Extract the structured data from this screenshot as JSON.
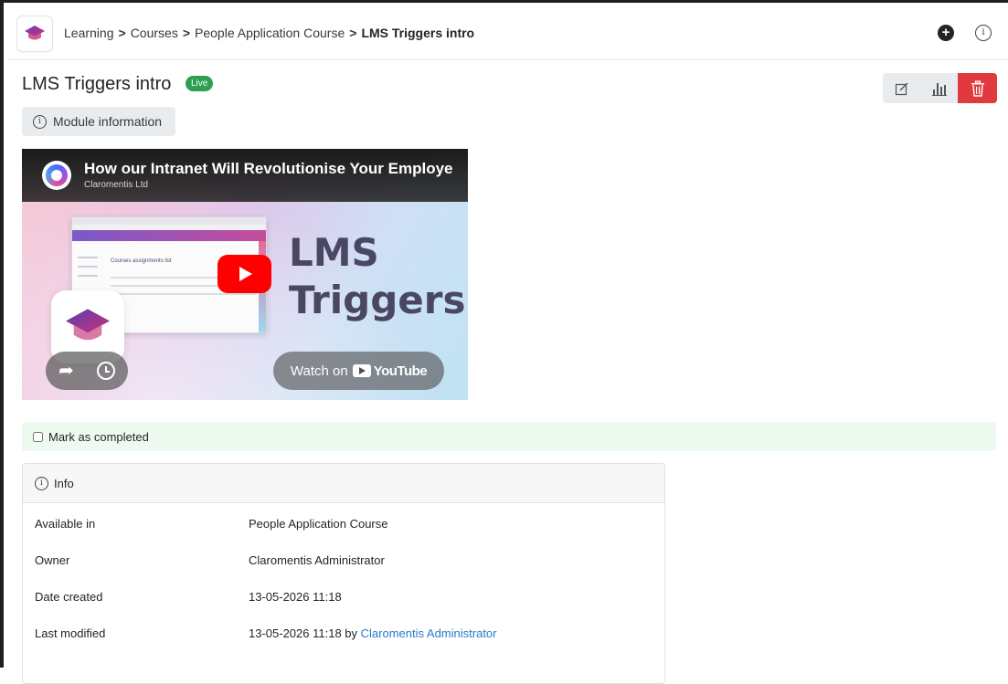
{
  "header": {
    "breadcrumb": [
      {
        "label": "Learning"
      },
      {
        "label": "Courses"
      },
      {
        "label": "People Application Course"
      }
    ],
    "separator": ">",
    "current": "LMS Triggers intro",
    "icons": {
      "add": "plus-circle-icon",
      "info": "info-circle-icon"
    }
  },
  "page": {
    "title": "LMS Triggers intro",
    "status_badge": "Live",
    "module_info_label": "Module information",
    "actions": [
      "edit-icon",
      "stats-icon",
      "trash-icon"
    ]
  },
  "video": {
    "title": "How our Intranet Will Revolutionise Your Employe",
    "channel": "Claromentis Ltd",
    "overlay_line1": "LMS",
    "overlay_line2": "Triggers",
    "inner_heading": "Courses assignments list",
    "watch_on": "Watch on",
    "youtube": "YouTube"
  },
  "completion": {
    "label": "Mark as completed",
    "checked": false
  },
  "info": {
    "heading": "Info",
    "rows": [
      {
        "label": "Available in",
        "value": "People Application Course"
      },
      {
        "label": "Owner",
        "value": "Claromentis Administrator"
      },
      {
        "label": "Date created",
        "value": "13-05-2026 11:18"
      },
      {
        "label": "Last modified",
        "value_text": "13-05-2026 11:18 by",
        "value_link": "Claromentis Administrator"
      }
    ]
  },
  "colors": {
    "live": "#2e9e4f",
    "delete": "#e03a3e",
    "link": "#2a7bc5",
    "completion_bg": "#eefaf0"
  }
}
